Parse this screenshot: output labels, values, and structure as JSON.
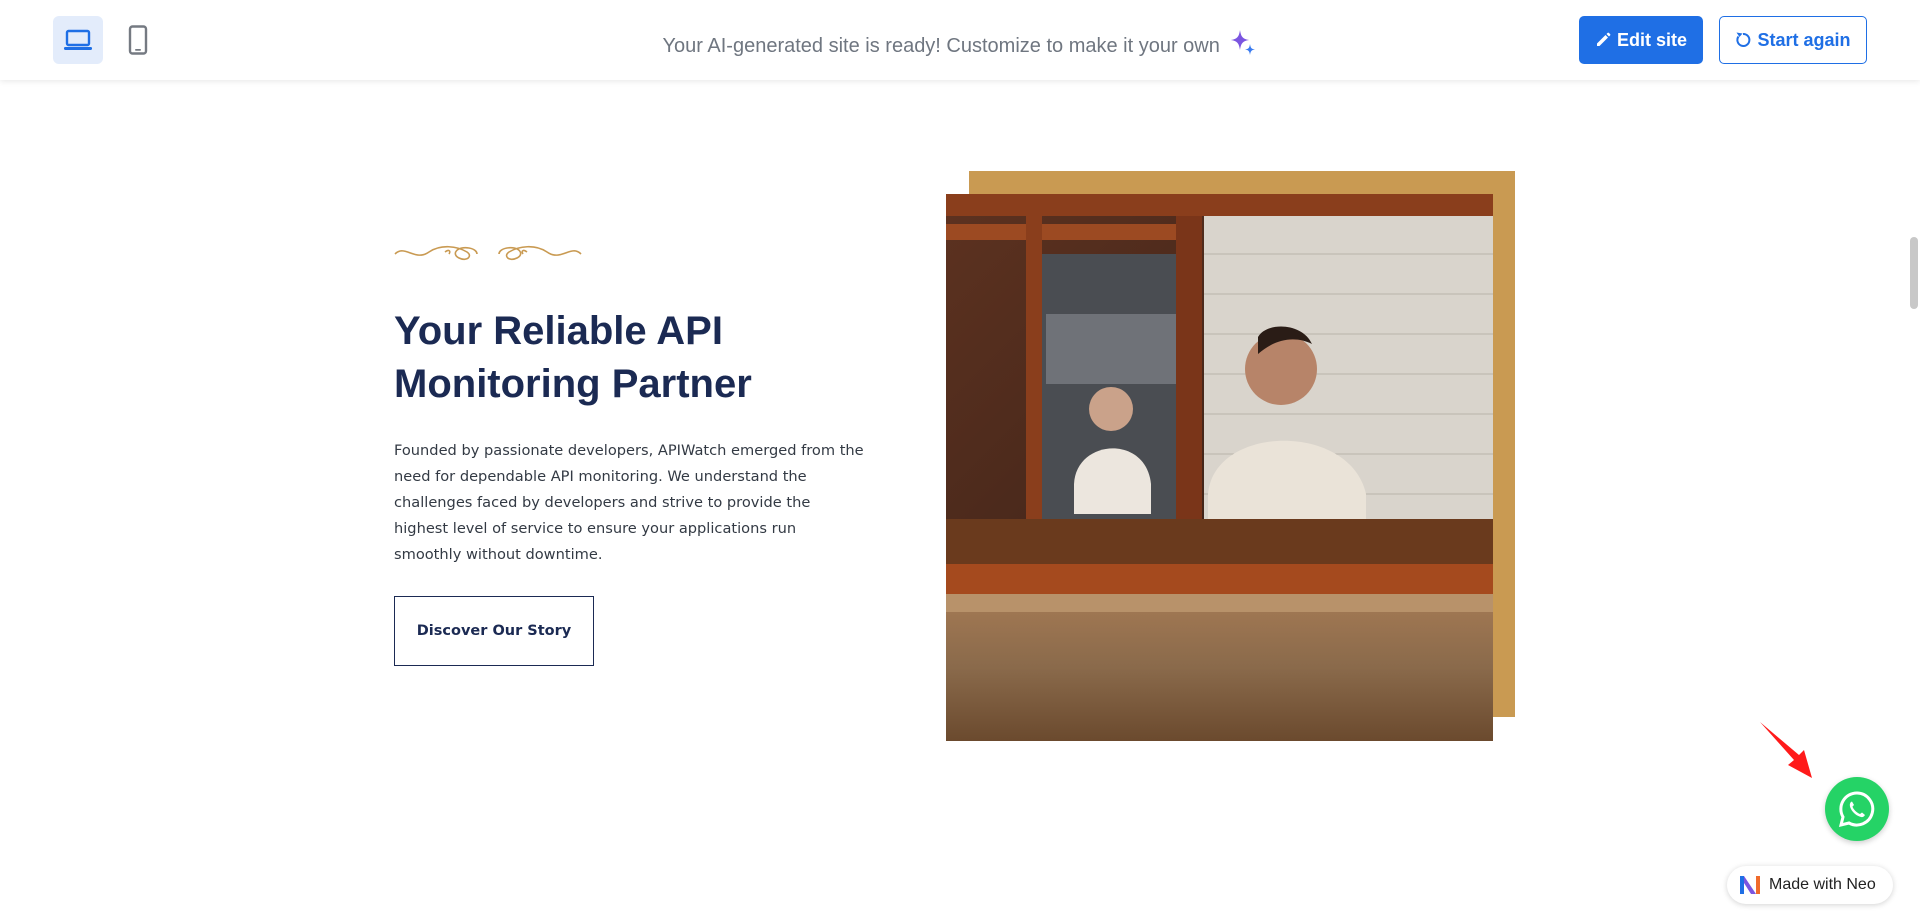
{
  "toolbar": {
    "banner_text": "Your AI-generated site is ready! Customize to make it your own",
    "edit_label": "Edit site",
    "restart_label": "Start again",
    "desktop_icon": "laptop-icon",
    "mobile_icon": "mobile-icon",
    "accent_color": "#1f6fe5"
  },
  "hero": {
    "heading": "Your Reliable API Monitoring Partner",
    "body": "Founded by passionate developers, APIWatch emerged from the need for dependable API monitoring. We understand the challenges faced by developers and strive to provide the highest level of service to ensure your applications run smoothly without downtime.",
    "cta_label": "Discover Our Story",
    "heading_color": "#1b2a53",
    "frame_color": "#c99a52"
  },
  "widgets": {
    "whatsapp_icon": "whatsapp-icon",
    "badge_label": "Made with Neo"
  }
}
